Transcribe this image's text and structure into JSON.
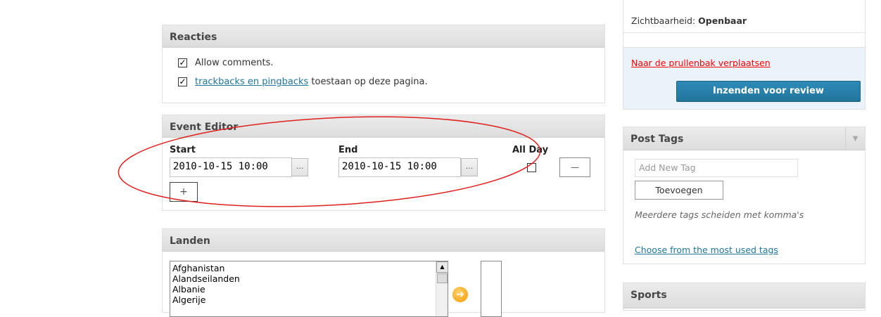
{
  "reacties": {
    "title": "Reacties",
    "allow_comments": "Allow comments.",
    "trackbacks_link": "trackbacks en pingbacks",
    "trackbacks_rest": " toestaan op deze pagina."
  },
  "event_editor": {
    "title": "Event Editor",
    "start_label": "Start",
    "end_label": "End",
    "allday_label": "All Day",
    "start_value": "2010-10-15 10:00",
    "end_value": "2010-10-15 10:00",
    "dots": "...",
    "remove_symbol": "—",
    "add_symbol": "+"
  },
  "landen": {
    "title": "Landen",
    "countries": [
      "Afghanistan",
      "Alandseilanden",
      "Albanie",
      "Algerije"
    ]
  },
  "publish": {
    "visibility_label": "Zichtbaarheid:",
    "visibility_value": "Openbaar",
    "trash_link": "Naar de prullenbak verplaatsen",
    "submit_label": "Inzenden voor review"
  },
  "post_tags": {
    "title": "Post Tags",
    "input_placeholder": "Add New Tag",
    "add_button": "Toevoegen",
    "hint": "Meerdere tags scheiden met komma's",
    "most_used_link": "Choose from the most used tags"
  },
  "sports": {
    "title": "Sports"
  },
  "colors": {
    "annotation": "#e0201e",
    "link": "#21759b",
    "submit_bg": "#21759b",
    "trash": "#ff0000"
  }
}
